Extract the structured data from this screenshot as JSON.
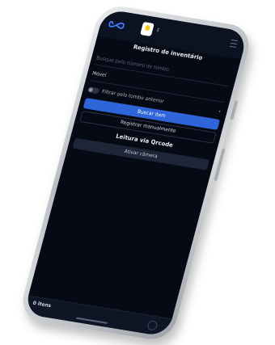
{
  "header": {
    "logo_icon": "infinity-logo-icon",
    "app_badge_icon": "app-badge-icon",
    "switcher_icon": "chevron-updown-icon",
    "menu_icon": "hamburger-menu-icon",
    "accent_color": "#3f7bff"
  },
  "form": {
    "title": "Registro de inventário",
    "search_placeholder": "Busque pelo número de tombo",
    "type_value": "Móvel",
    "filter_toggle_label": "Filtrar pelo tombo anterior",
    "filter_toggle_on": false,
    "search_button": "Buscar item",
    "manual_button": "Registrar manualmente"
  },
  "qrcode": {
    "title": "Leitura via Qrcode",
    "camera_button": "Ativar câmera"
  },
  "footer": {
    "item_count": "0 itens"
  },
  "colors": {
    "screen_background": "#050a14",
    "primary_button": "#2f65d9"
  }
}
